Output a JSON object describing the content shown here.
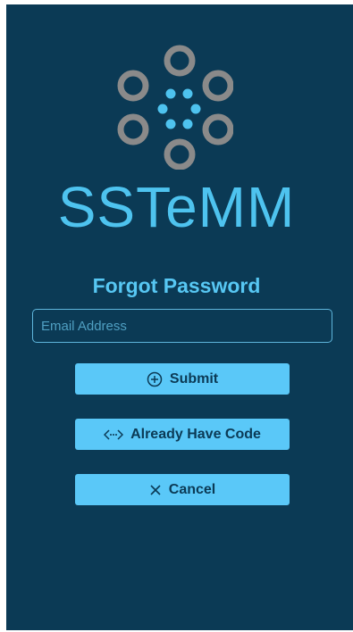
{
  "app": {
    "brand": "SSTeMM",
    "logo_icon": "sstemm-circles-logo"
  },
  "form": {
    "title": "Forgot Password",
    "email_placeholder": "Email Address",
    "email_value": ""
  },
  "buttons": {
    "submit_label": "Submit",
    "submit_icon": "plus-circle-icon",
    "code_label": "Already Have Code",
    "code_icon": "code-arrows-icon",
    "cancel_label": "Cancel",
    "cancel_icon": "close-icon"
  },
  "colors": {
    "background": "#0b3a55",
    "accent": "#5ac8f8",
    "logo_gray": "#8a8a8a",
    "logo_blue": "#4ec3ef"
  }
}
